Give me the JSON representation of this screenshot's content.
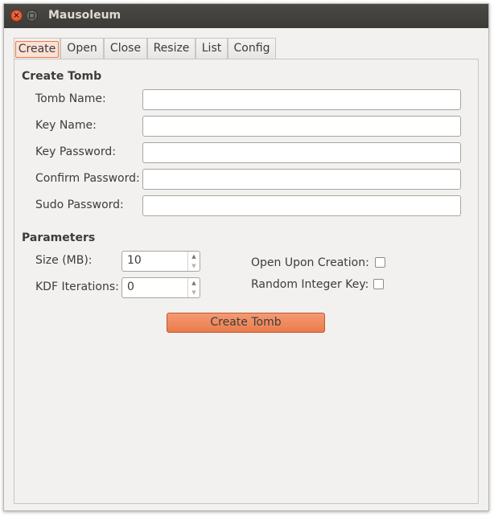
{
  "window": {
    "title": "Mausoleum",
    "close_glyph": "×"
  },
  "tabs": [
    {
      "label": "Create",
      "active": true
    },
    {
      "label": "Open"
    },
    {
      "label": "Close"
    },
    {
      "label": "Resize"
    },
    {
      "label": "List"
    },
    {
      "label": "Config"
    }
  ],
  "create_tomb": {
    "section_title": "Create Tomb",
    "fields": [
      {
        "label": "Tomb Name:",
        "value": ""
      },
      {
        "label": "Key Name:",
        "value": ""
      },
      {
        "label": "Key Password:",
        "value": ""
      },
      {
        "label": "Confirm Password:",
        "value": ""
      },
      {
        "label": "Sudo Password:",
        "value": ""
      }
    ]
  },
  "parameters": {
    "section_title": "Parameters",
    "size_label": "Size (MB):",
    "size_value": "10",
    "kdf_label": "KDF Iterations:",
    "kdf_value": "0",
    "open_upon_creation_label": "Open Upon Creation:",
    "open_upon_creation_checked": false,
    "random_integer_key_label": "Random Integer Key:",
    "random_integer_key_checked": false
  },
  "actions": {
    "create_button_label": "Create Tomb"
  },
  "colors": {
    "accent": "#ea7c4c",
    "titlebar": "#3c3b37",
    "window_bg": "#f2f1f0"
  }
}
